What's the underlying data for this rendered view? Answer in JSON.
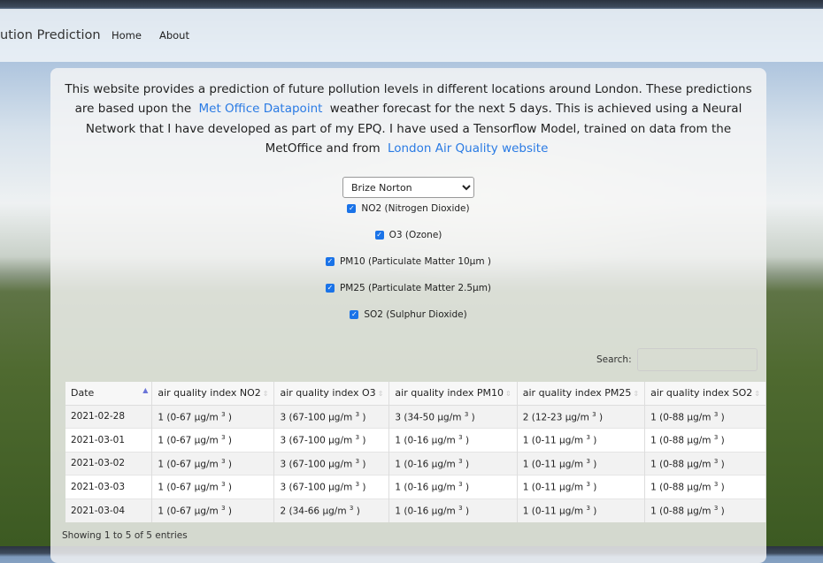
{
  "navbar": {
    "brand": "ution Prediction",
    "links": [
      "Home",
      "About"
    ]
  },
  "intro": {
    "text1": "This website provides a prediction of future pollution levels in different locations around London. These predictions are based upon the",
    "link1": "Met Office Datapoint",
    "text2": "weather forecast for the next 5 days. This is achieved using a Neural Network that I have developed as part of my EPQ. I have used a Tensorflow Model, trained on data from the MetOffice and from",
    "link2": "London Air Quality website"
  },
  "location_select": {
    "value": "Brize Norton"
  },
  "pollutants": [
    {
      "label": "NO2 (Nitrogen Dioxide)",
      "checked": true
    },
    {
      "label": "O3 (Ozone)",
      "checked": true
    },
    {
      "label": "PM10 (Particulate Matter 10µm )",
      "checked": true
    },
    {
      "label": "PM25 (Particulate Matter 2.5µm)",
      "checked": true
    },
    {
      "label": "SO2 (Sulphur Dioxide)",
      "checked": true
    }
  ],
  "search": {
    "label": "Search:",
    "value": ""
  },
  "table": {
    "headers": [
      "Date",
      "air quality index NO2",
      "air quality index O3",
      "air quality index PM10",
      "air quality index PM25",
      "air quality index SO2"
    ],
    "rows": [
      [
        "2021-02-28",
        "1 (0-67 µg/m",
        "3 (67-100 µg/m",
        "3 (34-50 µg/m",
        "2 (12-23 µg/m",
        "1 (0-88 µg/m"
      ],
      [
        "2021-03-01",
        "1 (0-67 µg/m",
        "3 (67-100 µg/m",
        "1 (0-16 µg/m",
        "1 (0-11 µg/m",
        "1 (0-88 µg/m"
      ],
      [
        "2021-03-02",
        "1 (0-67 µg/m",
        "3 (67-100 µg/m",
        "1 (0-16 µg/m",
        "1 (0-11 µg/m",
        "1 (0-88 µg/m"
      ],
      [
        "2021-03-03",
        "1 (0-67 µg/m",
        "3 (67-100 µg/m",
        "1 (0-16 µg/m",
        "1 (0-11 µg/m",
        "1 (0-88 µg/m"
      ],
      [
        "2021-03-04",
        "1 (0-67 µg/m",
        "2 (34-66 µg/m",
        "1 (0-16 µg/m",
        "1 (0-11 µg/m",
        "1 (0-88 µg/m"
      ]
    ],
    "unit_exp": "3"
  },
  "info": "Showing 1 to 5 of 5 entries"
}
